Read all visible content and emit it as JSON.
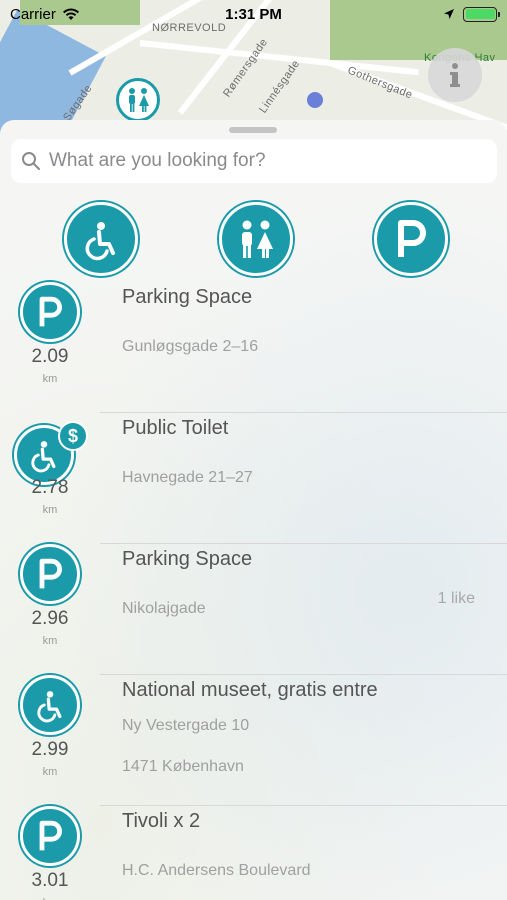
{
  "status_bar": {
    "carrier": "Carrier",
    "time": "1:31 PM"
  },
  "map": {
    "labels": {
      "district": "NØRREVOLD",
      "street_1": "Rømersgade",
      "street_2": "Linnésgade",
      "street_3": "Gothersgade",
      "street_4": "Søgade",
      "park": "Kongens Hav"
    }
  },
  "search": {
    "placeholder": "What are you looking for?"
  },
  "categories": [
    {
      "icon": "wheelchair-icon"
    },
    {
      "icon": "toilet-people-icon"
    },
    {
      "icon": "parking-icon"
    }
  ],
  "results": [
    {
      "icon": "parking-icon",
      "distance": "2.09",
      "unit": "km",
      "title": "Parking Space",
      "line2": "Gunløgsgade 2–16",
      "line3": "",
      "likes": ""
    },
    {
      "icon": "wheelchair-icon",
      "badge": "$",
      "distance": "2.78",
      "unit": "km",
      "title": "Public Toilet",
      "line2": "Havnegade 21–27",
      "line3": "",
      "likes": ""
    },
    {
      "icon": "parking-icon",
      "distance": "2.96",
      "unit": "km",
      "title": "Parking Space",
      "line2": "Nikolajgade",
      "line3": "",
      "likes": "1 like"
    },
    {
      "icon": "wheelchair-icon",
      "distance": "2.99",
      "unit": "km",
      "title": "National museet, gratis entre",
      "line2": "Ny Vestergade 10",
      "line3": "1471 København",
      "likes": ""
    },
    {
      "icon": "parking-icon",
      "distance": "3.01",
      "unit": "km",
      "title": "Tivoli x 2",
      "line2": "H.C. Andersens Boulevard",
      "line3": "",
      "likes": ""
    }
  ],
  "colors": {
    "accent": "#1b9aa9",
    "sheet_background": "#f5f6f4",
    "battery": "#4cd964"
  }
}
